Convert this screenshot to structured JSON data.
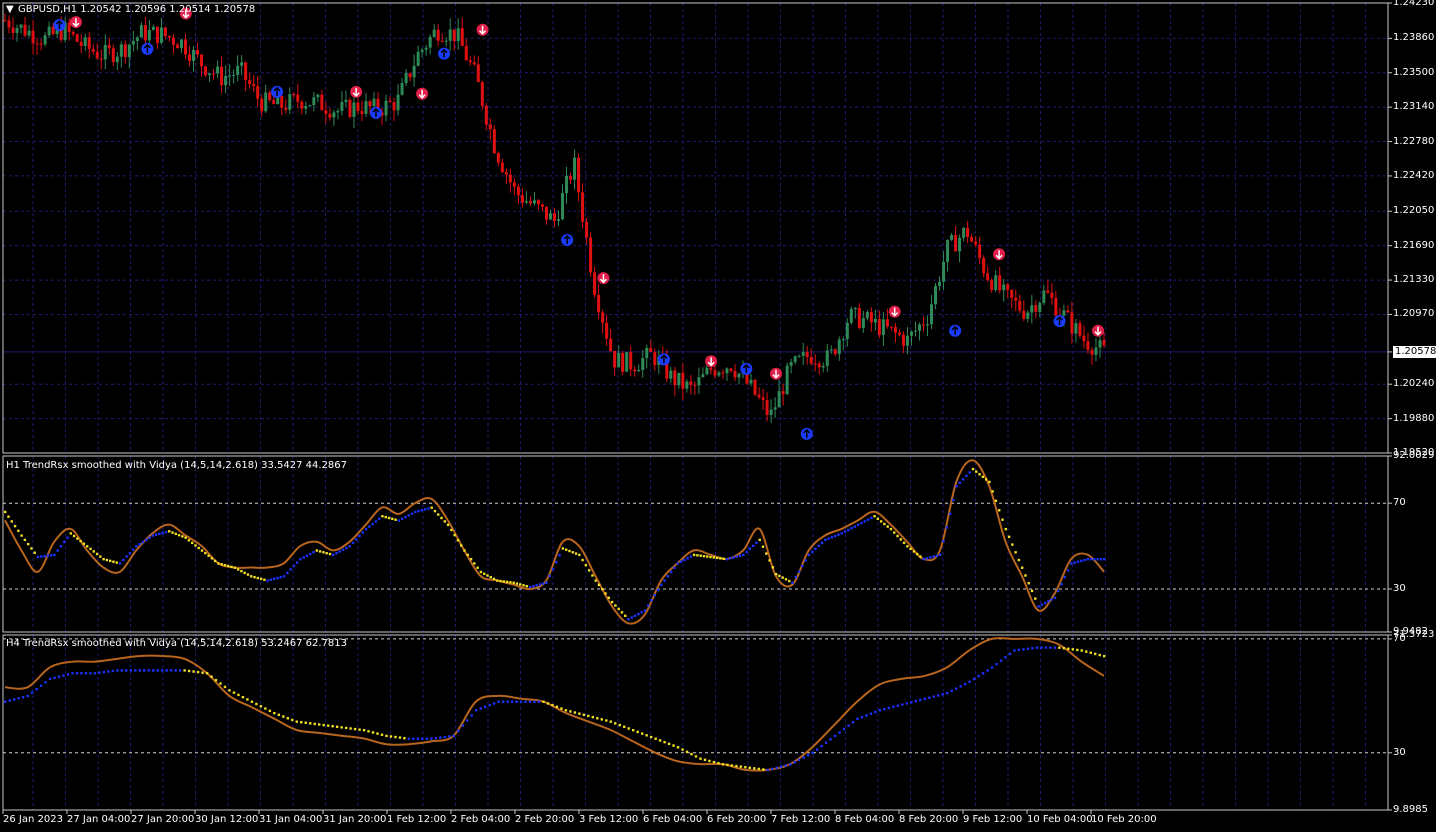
{
  "main": {
    "header": "GBPUSD,H1  1.20542 1.20596 1.20514 1.20578",
    "price_ticks": [
      "1.24230",
      "1.23860",
      "1.23500",
      "1.23140",
      "1.22780",
      "1.22420",
      "1.22050",
      "1.21690",
      "1.21330",
      "1.20970",
      "1.20578",
      "1.20240",
      "1.19880",
      "1.19520"
    ],
    "current_price": "1.20578"
  },
  "ind1": {
    "title": "H1 TrendRsx smoothed with Vidya (14,5,14,2.618) 33.5427 44.2867",
    "ticks": [
      "92.0029",
      "70",
      "30",
      "9.9482"
    ]
  },
  "ind2": {
    "title": "H4 TrendRsx smoothed with Vidya (14,5,14,2.618) 53.2467 62.7813",
    "ticks": [
      "71.3723",
      "70",
      "30",
      "9.8985"
    ]
  },
  "time_axis": [
    "26 Jan 2023",
    "27 Jan 04:00",
    "27 Jan 20:00",
    "30 Jan 12:00",
    "31 Jan 04:00",
    "31 Jan 20:00",
    "1 Feb 12:00",
    "2 Feb 04:00",
    "2 Feb 20:00",
    "3 Feb 12:00",
    "6 Feb 04:00",
    "6 Feb 20:00",
    "7 Feb 12:00",
    "8 Feb 04:00",
    "8 Feb 20:00",
    "9 Feb 12:00",
    "10 Feb 04:00",
    "10 Feb 20:00"
  ],
  "colors": {
    "background": "#000000",
    "grid": "#1c1c6e",
    "frame": "#c8c8c8",
    "bull": "#2e8b57",
    "bear": "#e01010",
    "buy_arrow": "#1a3cff",
    "sell_arrow": "#e0204a",
    "rsx_line": "#b8651e",
    "vidya_up": "#1a32ff",
    "vidya_down": "#f0e020",
    "price_line": "#1c1c6e"
  },
  "chart_data": [
    {
      "type": "candlestick",
      "title": "GBPUSD,H1",
      "ylim": [
        1.1952,
        1.2423
      ],
      "close_path": [
        1.2405,
        1.2395,
        1.2385,
        1.2395,
        1.2378,
        1.2368,
        1.2375,
        1.2392,
        1.239,
        1.2382,
        1.236,
        1.2345,
        1.2352,
        1.232,
        1.2315,
        1.2322,
        1.2318,
        1.231,
        1.2315,
        1.2312,
        1.232,
        1.2368,
        1.2395,
        1.239,
        1.2345,
        1.227,
        1.2225,
        1.221,
        1.2195,
        1.2255,
        1.213,
        1.205,
        1.2045,
        1.2055,
        1.203,
        1.2018,
        1.204,
        1.2045,
        1.202,
        1.199,
        1.204,
        1.2055,
        1.205,
        1.2095,
        1.209,
        1.208,
        1.207,
        1.2095,
        1.2165,
        1.2185,
        1.214,
        1.2115,
        1.21,
        1.212,
        1.2095,
        1.207,
        1.2058
      ],
      "buy_signals": [
        [
          0.055,
          1.24
        ],
        [
          0.135,
          1.2375
        ],
        [
          0.253,
          1.233
        ],
        [
          0.343,
          1.2308
        ],
        [
          0.405,
          1.237
        ],
        [
          0.517,
          1.2175
        ],
        [
          0.605,
          1.205
        ],
        [
          0.68,
          1.204
        ],
        [
          0.735,
          1.1972
        ],
        [
          0.87,
          1.208
        ],
        [
          0.965,
          1.209
        ]
      ],
      "sell_signals": [
        [
          0.07,
          1.2403
        ],
        [
          0.17,
          1.2412
        ],
        [
          0.325,
          1.233
        ],
        [
          0.385,
          1.2328
        ],
        [
          0.44,
          1.2395
        ],
        [
          0.55,
          1.2135
        ],
        [
          0.648,
          1.2048
        ],
        [
          0.707,
          1.2035
        ],
        [
          0.815,
          1.21
        ],
        [
          0.91,
          1.216
        ],
        [
          1.0,
          1.208
        ]
      ]
    },
    {
      "type": "line",
      "title": "H1 TrendRsx smoothed with Vidya (14,5,14,2.618)",
      "ylim": [
        9.9482,
        92.0029
      ],
      "series": [
        {
          "values": [
            62,
            48,
            38,
            52,
            58,
            48,
            40,
            38,
            48,
            56,
            60,
            55,
            50,
            42,
            40,
            40,
            40,
            42,
            50,
            52,
            48,
            52,
            60,
            68,
            65,
            70,
            72,
            62,
            48,
            36,
            34,
            32,
            30,
            34,
            52,
            50,
            36,
            22,
            14,
            18,
            34,
            42,
            48,
            46,
            44,
            48,
            58,
            36,
            32,
            48,
            55,
            58,
            62,
            66,
            60,
            52,
            44,
            48,
            80,
            90,
            78,
            52,
            36,
            20,
            28,
            44,
            46,
            38
          ]
        },
        {
          "values": [
            66,
            55,
            45,
            46,
            56,
            50,
            44,
            42,
            50,
            55,
            57,
            54,
            48,
            42,
            40,
            36,
            34,
            36,
            44,
            48,
            46,
            50,
            58,
            64,
            62,
            66,
            68,
            60,
            48,
            38,
            34,
            33,
            31,
            33,
            49,
            46,
            34,
            24,
            16,
            20,
            32,
            42,
            46,
            45,
            44,
            46,
            53,
            37,
            33,
            46,
            53,
            56,
            60,
            64,
            58,
            50,
            44,
            46,
            78,
            86,
            80,
            58,
            40,
            22,
            26,
            42,
            44,
            44
          ]
        }
      ]
    },
    {
      "type": "line",
      "title": "H4 TrendRsx smoothed with Vidya (14,5,14,2.618)",
      "ylim": [
        9.8985,
        71.3723
      ],
      "series": [
        {
          "values": [
            53,
            53,
            60,
            62,
            62,
            63,
            64,
            64,
            63,
            58,
            50,
            46,
            42,
            38,
            37,
            36,
            35,
            33,
            33,
            34,
            36,
            48,
            50,
            49,
            48,
            44,
            41,
            38,
            34,
            30,
            27,
            26,
            26,
            24,
            24,
            26,
            32,
            40,
            48,
            54,
            56,
            57,
            60,
            66,
            70,
            70,
            70,
            68,
            62,
            57
          ]
        },
        {
          "values": [
            48,
            50,
            56,
            58,
            58,
            59,
            59,
            59,
            59,
            58,
            52,
            48,
            44,
            41,
            40,
            39,
            38,
            36,
            35,
            35,
            36,
            45,
            48,
            48,
            48,
            45,
            43,
            41,
            38,
            35,
            32,
            28,
            26,
            25,
            24,
            26,
            30,
            36,
            42,
            45,
            47,
            49,
            51,
            55,
            60,
            66,
            67,
            67,
            66,
            64
          ]
        }
      ]
    }
  ]
}
